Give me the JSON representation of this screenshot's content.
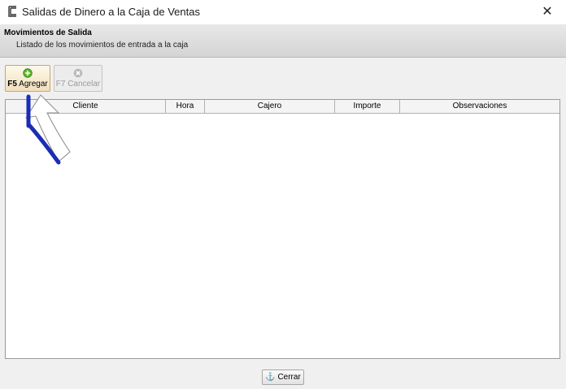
{
  "window": {
    "title": "Salidas de Dinero a la Caja de Ventas",
    "close_glyph": "✕"
  },
  "header": {
    "title": "Movimientos de Salida",
    "subtitle": "Listado de los movimientos de entrada a la caja"
  },
  "toolbar": {
    "add": {
      "key": "F5",
      "label": "Agregar",
      "icon": "plus-circle-icon",
      "enabled": true
    },
    "cancel": {
      "label": "F7 Cancelar",
      "icon": "x-circle-icon",
      "enabled": false
    }
  },
  "table": {
    "columns": [
      "Cliente",
      "Hora",
      "Cajero",
      "Importe",
      "Observaciones"
    ],
    "rows": []
  },
  "footer": {
    "close_label": "Cerrar",
    "close_icon": "anchor-icon"
  },
  "colors": {
    "annotation_arrow": "#1a2db5"
  }
}
